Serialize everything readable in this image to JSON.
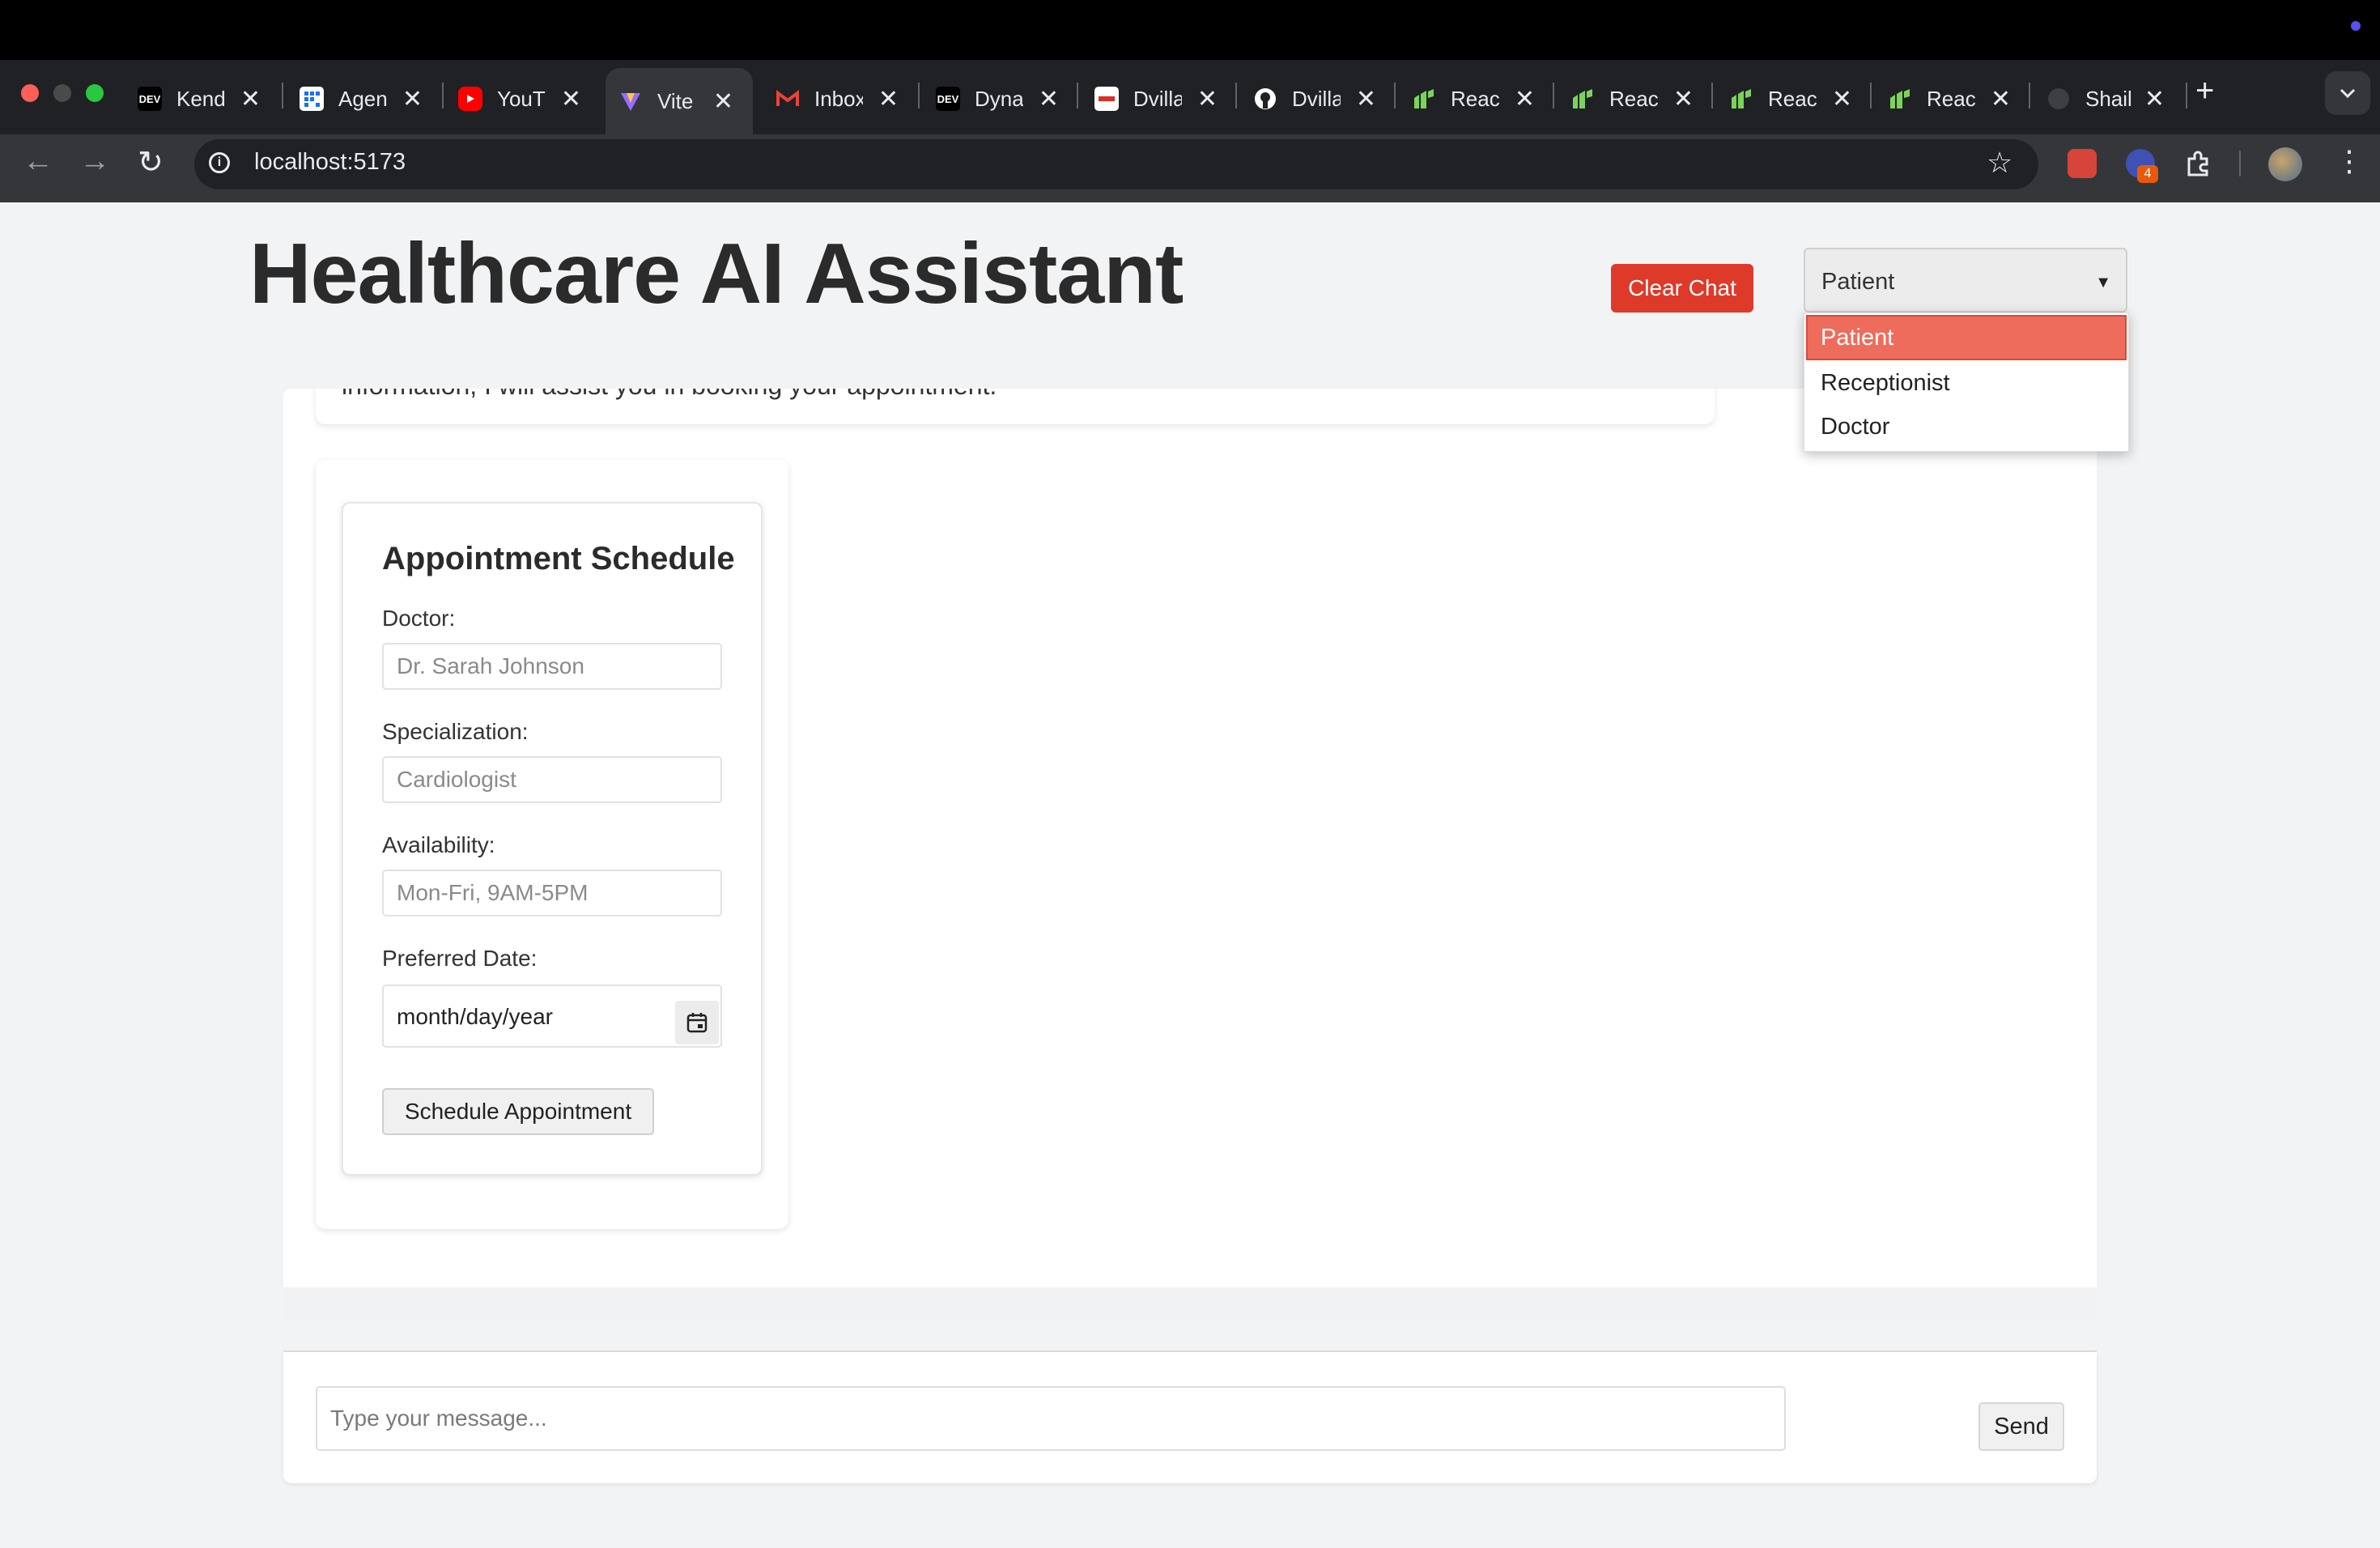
{
  "browser": {
    "tabs": [
      {
        "title": "Kendo",
        "icon": "dev-icon",
        "color": "#000000"
      },
      {
        "title": "Agent",
        "icon": "grid-icon",
        "color": "#1a73e8"
      },
      {
        "title": "YouTube",
        "icon": "youtube-icon",
        "color": "#ff0000"
      },
      {
        "title": "Vite",
        "icon": "vite-icon",
        "color": "#9a6bff",
        "active": true
      },
      {
        "title": "Inbox",
        "icon": "gmail-icon",
        "color": "#ea4335"
      },
      {
        "title": "Dynamic",
        "icon": "dev-icon",
        "color": "#000000"
      },
      {
        "title": "Dvilla",
        "icon": "dvilla-icon",
        "color": "#d93025"
      },
      {
        "title": "Dvilla",
        "icon": "github-icon",
        "color": "#ffffff"
      },
      {
        "title": "React",
        "icon": "leaf-icon",
        "color": "#7cd35a"
      },
      {
        "title": "React",
        "icon": "leaf-icon",
        "color": "#7cd35a"
      },
      {
        "title": "React",
        "icon": "leaf-icon",
        "color": "#7cd35a"
      },
      {
        "title": "React",
        "icon": "leaf-icon",
        "color": "#7cd35a"
      },
      {
        "title": "Shail",
        "icon": "github-icon",
        "color": "#555555"
      }
    ],
    "dev_label": "DEV",
    "new_tab": "+",
    "url": "localhost:5173",
    "extension_badge": "4"
  },
  "page": {
    "title": "Healthcare AI Assistant",
    "clear_chat": "Clear Chat",
    "role_select": {
      "selected": "Patient",
      "options": [
        "Patient",
        "Receptionist",
        "Doctor"
      ]
    },
    "chat": {
      "message_partial": "information, I will assist you in booking your appointment."
    },
    "appointment": {
      "title": "Appointment Schedule",
      "doctor_label": "Doctor:",
      "doctor_placeholder": "Dr. Sarah Johnson",
      "specialization_label": "Specialization:",
      "specialization_placeholder": "Cardiologist",
      "availability_label": "Availability:",
      "availability_placeholder": "Mon-Fri, 9AM-5PM",
      "date_label": "Preferred Date:",
      "date_value": "month/day/year",
      "submit": "Schedule Appointment"
    },
    "composer": {
      "placeholder": "Type your message...",
      "send": "Send"
    }
  },
  "colors": {
    "accent_red": "#dd3a2a",
    "dropdown_selected": "#ee6c5b",
    "page_bg": "#f2f3f5"
  }
}
